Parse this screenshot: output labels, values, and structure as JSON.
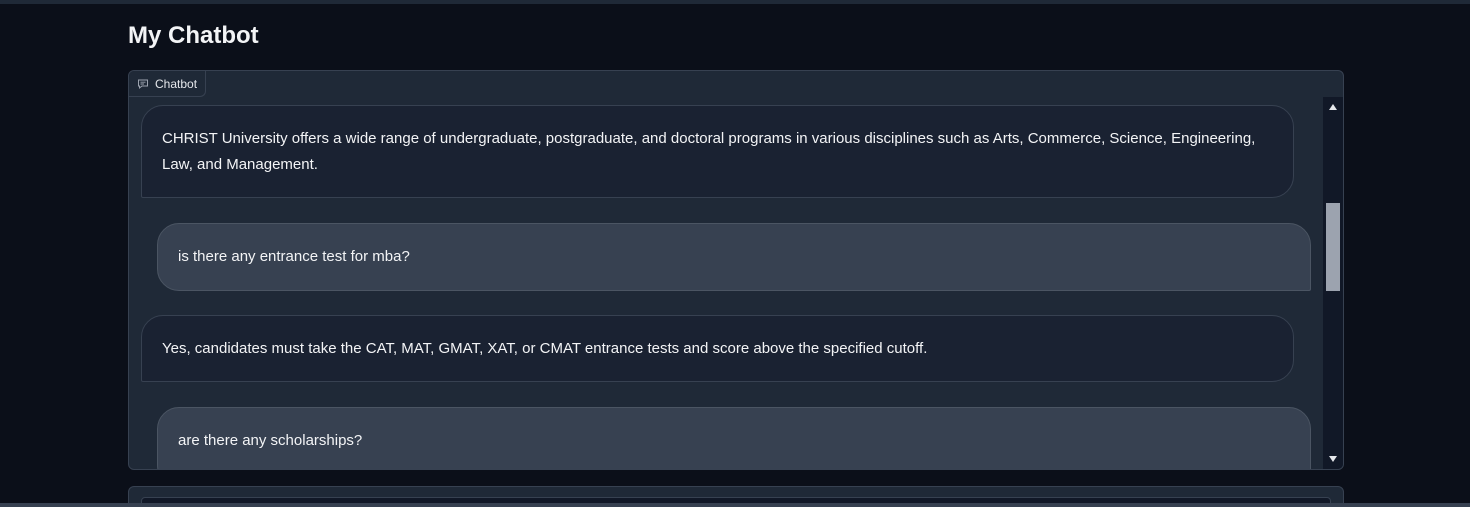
{
  "header": {
    "title": "My Chatbot"
  },
  "chatbot": {
    "label": "Chatbot",
    "label_icon": "chat-bubble-icon",
    "messages": [
      {
        "role": "bot",
        "lines": [
          "CHRIST University offers a wide range of undergraduate, postgraduate, and doctoral programs in various disciplines such as Arts, Commerce, Science, Engineering,",
          "Law, and Management."
        ]
      },
      {
        "role": "user",
        "lines": [
          "is there any entrance test for mba?"
        ]
      },
      {
        "role": "bot",
        "lines": [
          "Yes, candidates must take the CAT, MAT, GMAT, XAT, or CMAT entrance tests and score above the specified cutoff."
        ]
      },
      {
        "role": "user",
        "lines": [
          "are there any scholarships?"
        ]
      }
    ]
  },
  "scrollbar": {
    "up_icon": "triangle-up-icon",
    "down_icon": "triangle-down-icon"
  },
  "colors": {
    "background": "#0b0f19",
    "panel": "#1f2937",
    "user_bubble": "#374151",
    "bot_bubble": "#1a2232",
    "link": "#3b82f6"
  }
}
